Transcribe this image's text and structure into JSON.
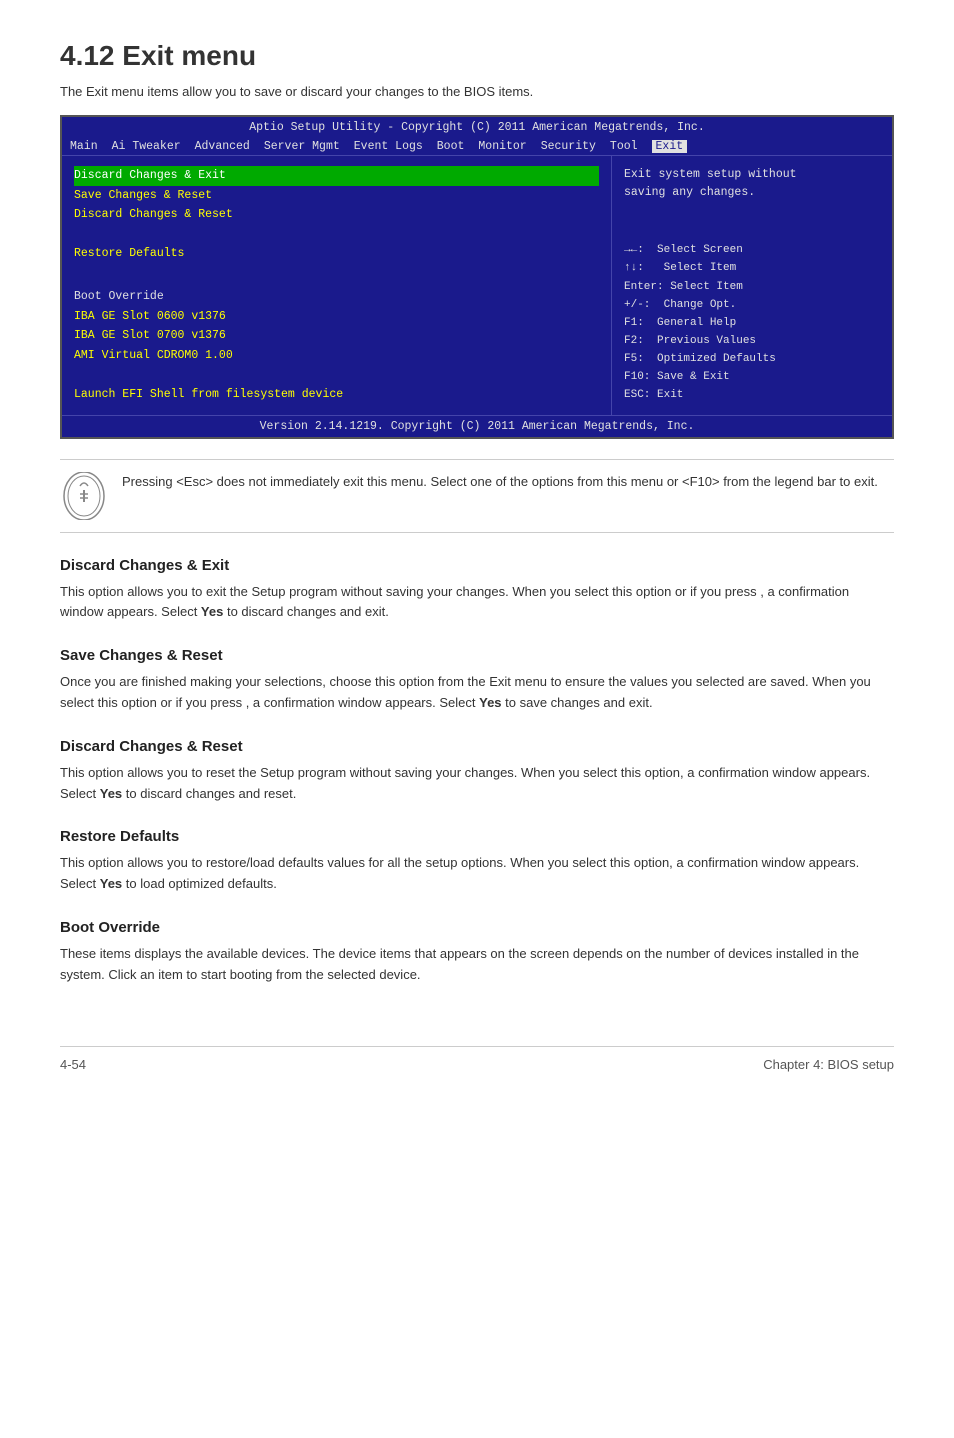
{
  "page": {
    "title": "4.12  Exit menu",
    "intro": "The Exit menu items allow you to save or discard your changes to the BIOS items.",
    "footer_left": "4-54",
    "footer_right": "Chapter 4: BIOS setup"
  },
  "bios": {
    "header": "Aptio Setup Utility - Copyright (C) 2011 American Megatrends, Inc.",
    "menubar": [
      "Main",
      "Ai Tweaker",
      "Advanced",
      "Server Mgmt",
      "Event Logs",
      "Boot",
      "Monitor",
      "Security",
      "Tool",
      "Exit"
    ],
    "active_menu": "Exit",
    "left_items": [
      "Discard Changes & Exit",
      "Save Changes & Reset",
      "Discard Changes & Reset",
      "",
      "Restore Defaults",
      "",
      "Boot Override",
      "IBA GE Slot 0600 v1376",
      "IBA GE Slot 0700 v1376",
      "AMI Virtual CDROM0 1.00",
      "",
      "Launch EFI Shell from filesystem device"
    ],
    "right_description": "Exit system setup without saving any changes.",
    "right_legend": [
      "→←:  Select Screen",
      "↑↓:   Select Item",
      "Enter: Select Item",
      "+/-:  Change Opt.",
      "F1:  General Help",
      "F2:  Previous Values",
      "F5:  Optimized Defaults",
      "F10: Save & Exit",
      "ESC: Exit"
    ],
    "footer": "Version 2.14.1219. Copyright (C) 2011 American Megatrends, Inc."
  },
  "note": {
    "text": "Pressing <Esc> does not immediately exit this menu. Select one of the options from this menu or <F10> from the legend bar to exit."
  },
  "sections": [
    {
      "id": "discard-exit",
      "heading": "Discard Changes & Exit",
      "body": "This option allows you to exit the Setup program without saving your changes. When you select this option or if you press <Esc>, a confirmation window appears. Select Yes to discard changes and exit."
    },
    {
      "id": "save-reset",
      "heading": "Save Changes & Reset",
      "body": "Once you are finished making your selections, choose this option from the Exit menu to ensure the values you selected are saved. When you select this option or if you press <F10>, a confirmation window appears. Select Yes to save changes and exit."
    },
    {
      "id": "discard-reset",
      "heading": "Discard Changes & Reset",
      "body": "This option allows you to reset the Setup program without saving your changes. When you select this option, a confirmation window appears. Select Yes to discard changes and reset."
    },
    {
      "id": "restore-defaults",
      "heading": "Restore Defaults",
      "body": "This option allows you to restore/load defaults values for all the setup options. When you select this option, a confirmation window appears. Select Yes to load optimized defaults."
    },
    {
      "id": "boot-override",
      "heading": "Boot Override",
      "body": "These items displays the available devices. The device items that appears on the screen depends on the number of devices installed in the system. Click an item to start booting from the selected device."
    }
  ]
}
